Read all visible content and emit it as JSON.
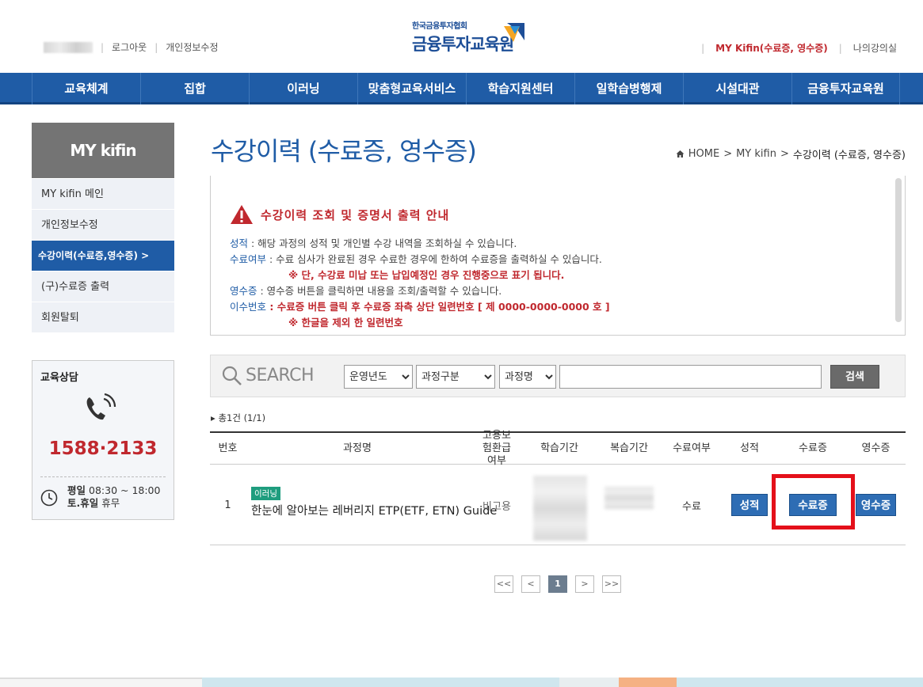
{
  "header": {
    "logout": "로그아웃",
    "edit_profile": "개인정보수정",
    "logo_small": "한국금융투자협회",
    "logo_big": "금융투자교육원",
    "my_kifin": "MY Kifin(수료증, 영수증)",
    "my_lectures": "나의강의실"
  },
  "nav": [
    "교육체계",
    "집합",
    "이러닝",
    "맞춤형교육서비스",
    "학습지원센터",
    "일학습병행제",
    "시설대관",
    "금융투자교육원"
  ],
  "sidebar": {
    "title": "MY kifin",
    "items": [
      "MY kifin 메인",
      "개인정보수정",
      "수강이력(수료증,영수증) >",
      "(구)수료증 출력",
      "회원탈퇴"
    ],
    "consult_title": "교육상담",
    "phone": "1588·2133",
    "weekday_label": "평일",
    "weekday_hours": "08:30 ~ 18:00",
    "holiday_label": "토.휴일",
    "holiday_hours": "휴무"
  },
  "page": {
    "title": "수강이력 (수료증, 영수증)",
    "breadcrumb": [
      "HOME",
      "MY kifin",
      "수강이력 (수료증, 영수증)"
    ]
  },
  "notice": {
    "title": "수강이력 조회 및 증명서 출력 안내",
    "l1_key": "성적",
    "l1_text": " : 해당 과정의 성적 및 개인별 수강 내역을 조회하실 수 있습니다.",
    "l2_key": "수료여부",
    "l2_text": " : 수료 심사가 완료된 경우 수료한 경우에 한하여 수료증을 출력하실 수 있습니다.",
    "l3_red": "※ 단, 수강료 미납 또는 납입예정인 경우 진행중으로 표기 됩니다.",
    "l4_key": "영수증",
    "l4_text": " : 영수증 버튼을 클릭하면 내용을 조회/출력할 수 있습니다.",
    "l5_key": "이수번호",
    "l5_red": " : 수료증 버튼 클릭 후 수료증 좌측 상단 일련번호 [ 제 0000-0000-0000 호 ]",
    "l6_red": "※ 한글을 제외 한 일련번호"
  },
  "search": {
    "label": "SEARCH",
    "year": "운영년도",
    "category": "과정구분",
    "field": "과정명",
    "button": "검색"
  },
  "list": {
    "total": "총1건 (1/1)",
    "headers": [
      "번호",
      "과정명",
      "고용보험환급여부",
      "학습기간",
      "복습기간",
      "수료여부",
      "성적",
      "수료증",
      "영수증"
    ],
    "rows": [
      {
        "no": "1",
        "badge": "이러닝",
        "course": "한눈에 알아보는 레버리지 ETP(ETF, ETN) Guide",
        "refund": "비고용",
        "completed": "수료",
        "grade_btn": "성적",
        "cert_btn": "수료증",
        "receipt_btn": "영수증"
      }
    ]
  },
  "pager": {
    "first": "<<",
    "prev": "<",
    "current": "1",
    "next": ">",
    "last": ">>"
  },
  "colors": {
    "primary": "#1f5ca6",
    "accent_red": "#c0282e",
    "highlight_box": "#e4101a"
  }
}
